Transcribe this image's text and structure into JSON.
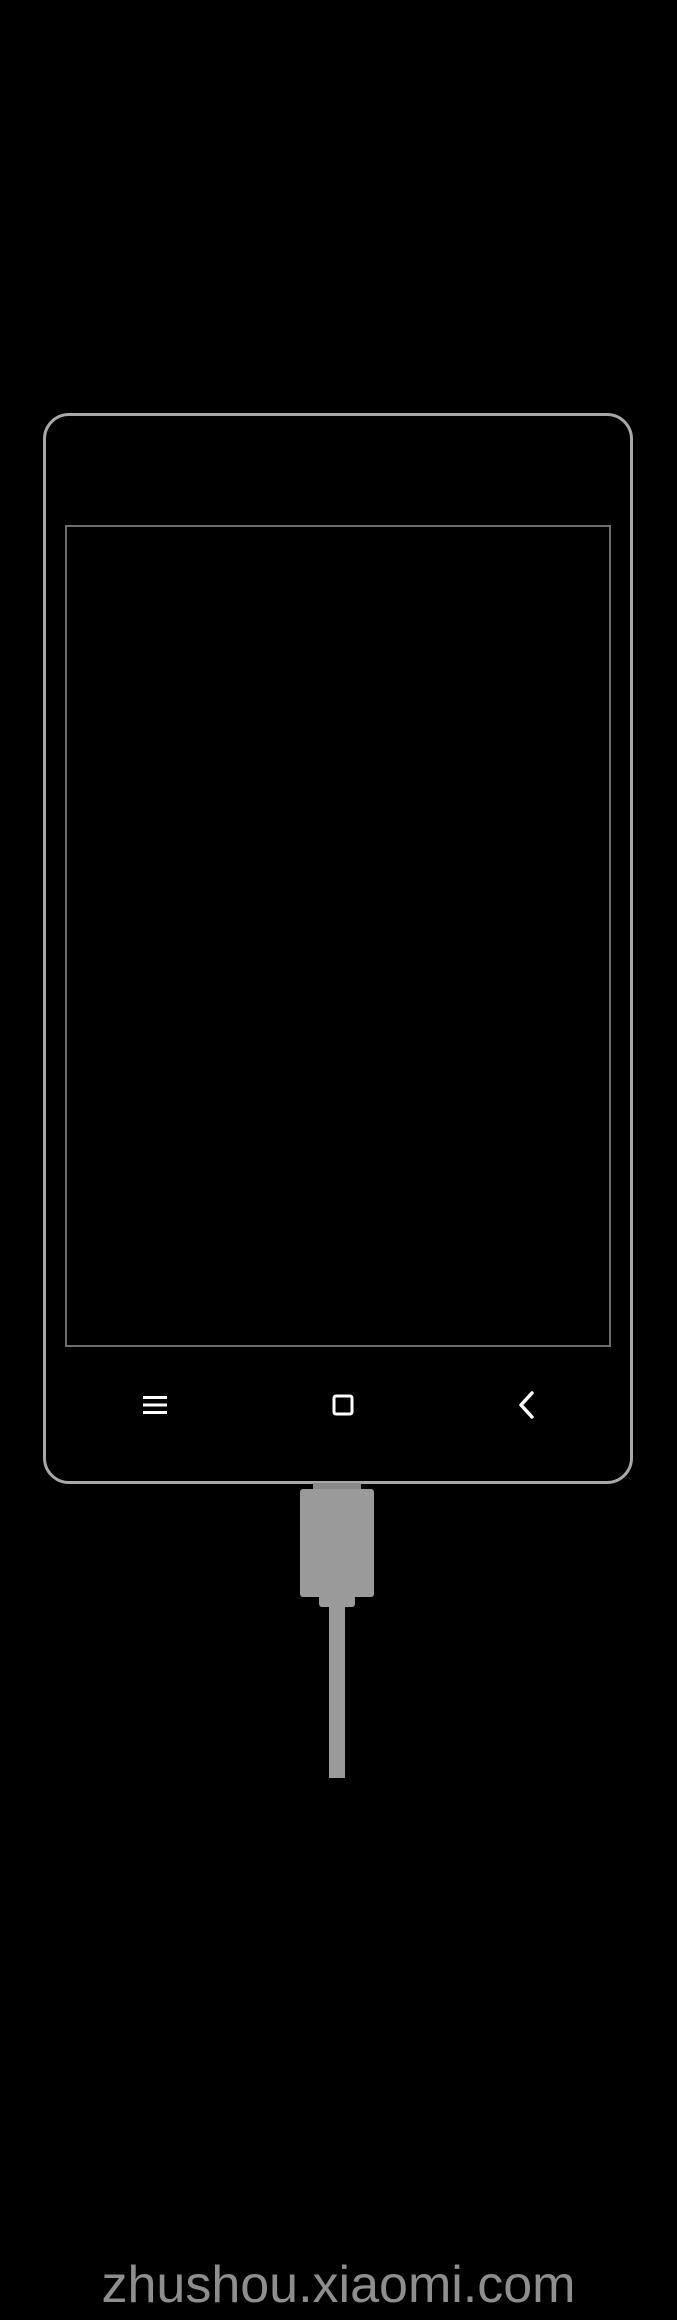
{
  "device": {
    "frame_color": "#a8a8a8",
    "screen_border_color": "#6e6e6e",
    "background_color": "#000000"
  },
  "nav_bar": {
    "icons": [
      "menu-icon",
      "home-icon",
      "back-icon"
    ],
    "icon_color": "#ffffff"
  },
  "cable": {
    "color": "#9a9a9a",
    "icon": "usb-cable-icon"
  },
  "footer": {
    "watermark": "zhushou.xiaomi.com",
    "color": "#8e8e8e"
  }
}
